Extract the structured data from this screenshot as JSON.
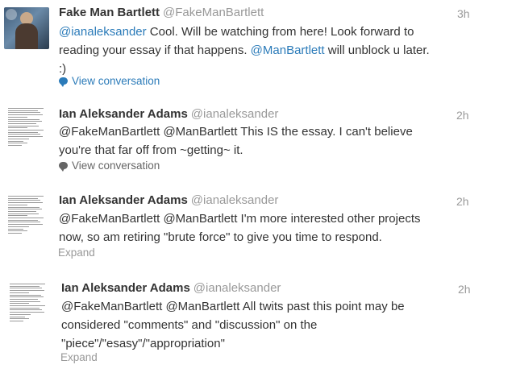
{
  "tweets": [
    {
      "name": "Fake Man Bartlett",
      "handle": "@FakeManBartlett",
      "time": "3h",
      "avatar": "person-photo-icon",
      "lines": [
        [
          {
            "t": "@ianaleksander",
            "m": true
          },
          {
            "t": " Cool. Will be watching from here! Look forward to",
            "m": false
          }
        ],
        [
          {
            "t": "reading your essay if that happens. ",
            "m": false
          },
          {
            "t": "@ManBartlett",
            "m": true
          },
          {
            "t": " will unblock u later.",
            "m": false
          }
        ],
        [
          {
            "t": ":)",
            "m": false
          }
        ]
      ],
      "action": "View conversation"
    },
    {
      "name": "Ian Aleksander Adams",
      "handle": "@ianaleksander",
      "time": "2h",
      "avatar": "document-thumbnail-icon",
      "lines": [
        [
          {
            "t": "@FakeManBartlett @ManBartlett This IS the essay. I can't believe",
            "m": false
          }
        ],
        [
          {
            "t": "you're that far off from ~getting~ it.",
            "m": false
          }
        ]
      ],
      "action": "View conversation"
    },
    {
      "name": "Ian Aleksander Adams",
      "handle": "@ianaleksander",
      "time": "2h",
      "avatar": "document-thumbnail-icon",
      "lines": [
        [
          {
            "t": "@FakeManBartlett @ManBartlett I'm more interested other projects",
            "m": false
          }
        ],
        [
          {
            "t": "now, so am retiring \"brute force\" to give you time to respond.",
            "m": false
          }
        ]
      ],
      "action": "Expand"
    },
    {
      "name": "Ian Aleksander Adams",
      "handle": "@ianaleksander",
      "time": "2h",
      "avatar": "document-thumbnail-icon",
      "lines": [
        [
          {
            "t": "@FakeManBartlett @ManBartlett All twits past this point may be",
            "m": false
          }
        ],
        [
          {
            "t": "considered \"comments\" and \"discussion\" on the",
            "m": false
          }
        ],
        [
          {
            "t": "\"piece\"/\"esasy\"/\"appropriation\"",
            "m": false
          }
        ]
      ],
      "action": "Expand"
    }
  ],
  "colors": {
    "link": "#2b7bb9",
    "muted": "#999999",
    "text": "#333333"
  }
}
